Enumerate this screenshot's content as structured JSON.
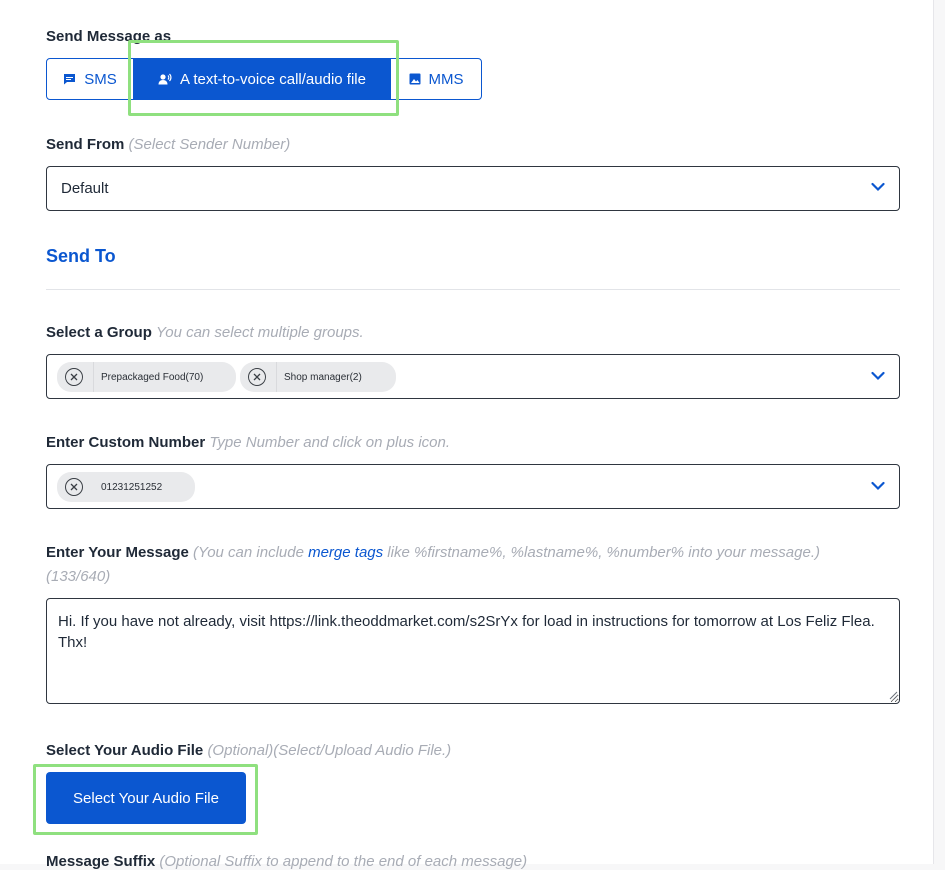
{
  "send_as": {
    "label": "Send Message as",
    "options": [
      {
        "label": "SMS",
        "icon": "chat-bubble-icon",
        "selected": false
      },
      {
        "label": "A text-to-voice call/audio file",
        "icon": "voice-person-icon",
        "selected": true
      },
      {
        "label": "MMS",
        "icon": "image-icon",
        "selected": false
      }
    ]
  },
  "send_from": {
    "label": "Send From",
    "hint": "(Select Sender Number)",
    "value": "Default"
  },
  "send_to": {
    "title": "Send To"
  },
  "group": {
    "label": "Select a Group",
    "hint": "You can select multiple groups.",
    "chips": [
      "Prepackaged Food(70)",
      "Shop manager(2)"
    ]
  },
  "custom_number": {
    "label": "Enter Custom Number",
    "hint": "Type Number and click on plus icon.",
    "chips": [
      "01231251252"
    ]
  },
  "message": {
    "label": "Enter Your Message",
    "hint_before": "(You can include ",
    "hint_link": "merge tags",
    "hint_after": " like %firstname%, %lastname%, %number% into your message.)",
    "counter": "(133/640)",
    "text": "Hi. If you have not already, visit https://link.theoddmarket.com/s2SrYx for load in instructions for tomorrow at Los Feliz Flea. Thx!"
  },
  "audio": {
    "label": "Select Your Audio File",
    "hint": "(Optional)(Select/Upload Audio File.)",
    "button_label": "Select Your Audio File"
  },
  "message_suffix": {
    "label": "Message Suffix",
    "hint": "(Optional Suffix to append to the end of each message)"
  },
  "colors": {
    "accent": "#0b57d0",
    "highlight": "#8fe07f"
  }
}
